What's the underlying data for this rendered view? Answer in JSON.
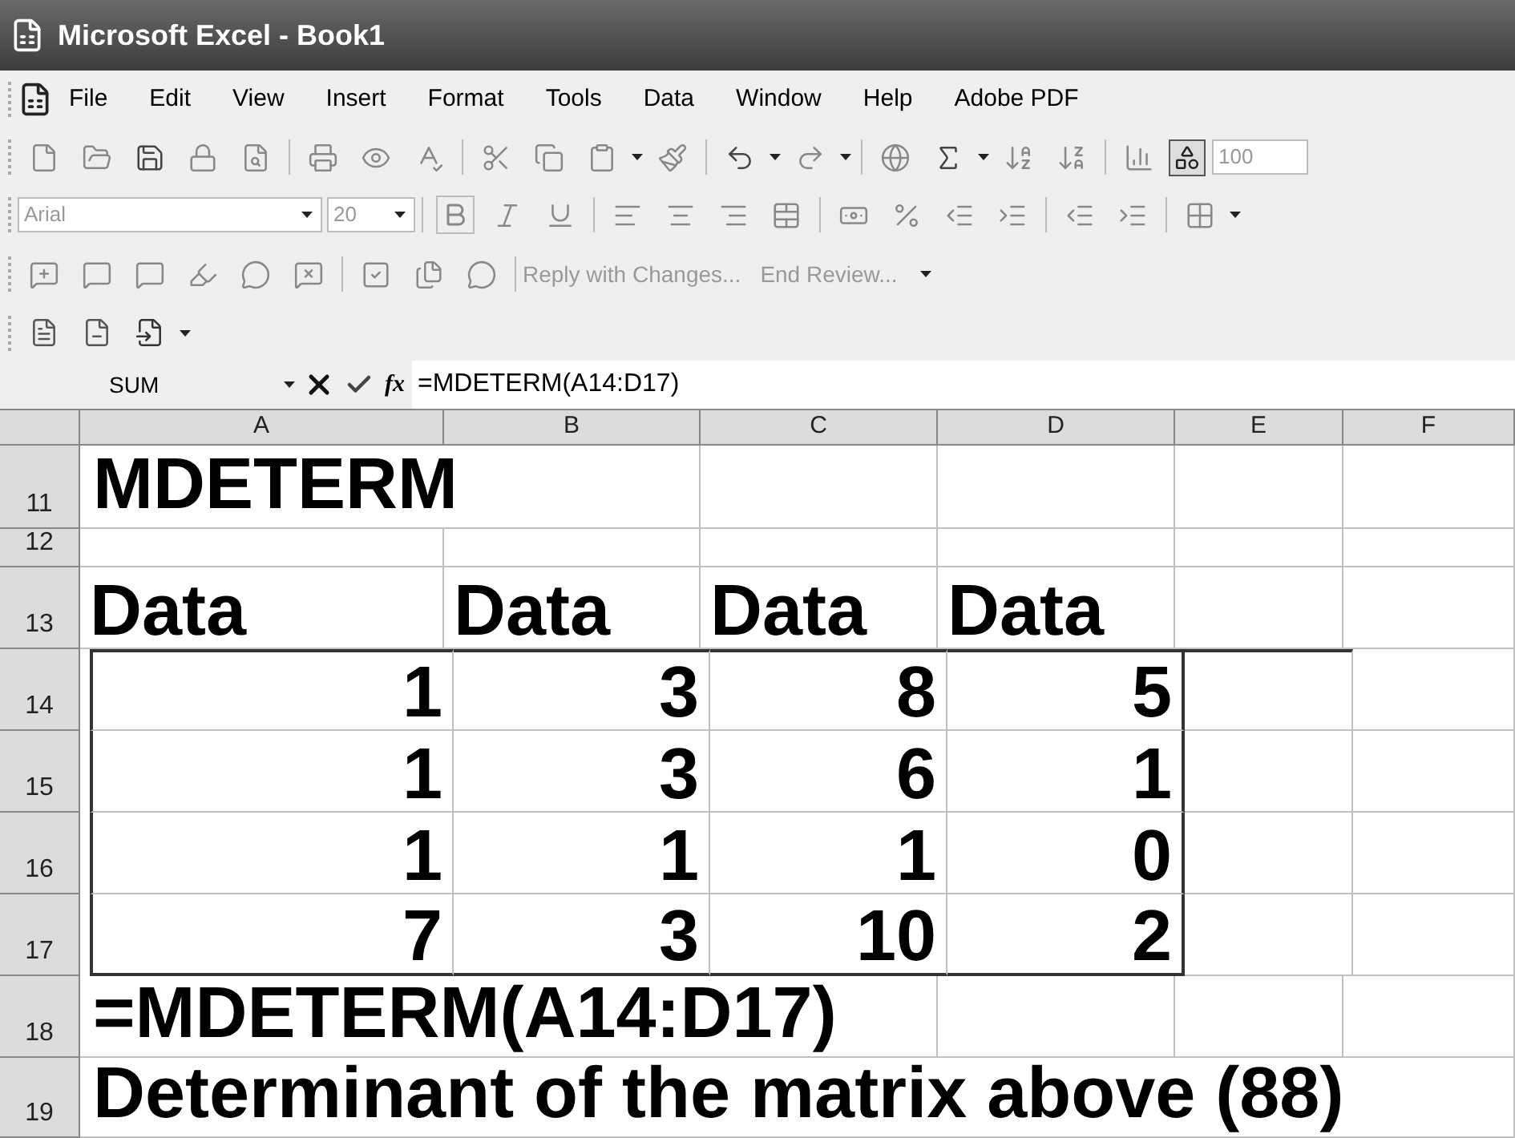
{
  "window": {
    "title": "Microsoft Excel - Book1"
  },
  "menu": [
    "File",
    "Edit",
    "View",
    "Insert",
    "Format",
    "Tools",
    "Data",
    "Window",
    "Help",
    "Adobe PDF"
  ],
  "standard_toolbar": {
    "zoom": "100"
  },
  "formatting_toolbar": {
    "font": "Arial",
    "size": "20"
  },
  "reviewing_toolbar": {
    "buttons": [
      "Reply with Changes...",
      "End Review..."
    ]
  },
  "formula_bar": {
    "name_box": "SUM",
    "function_label": "fx",
    "formula": "=MDETERM(A14:D17)"
  },
  "sheet": {
    "columns": [
      "A",
      "B",
      "C",
      "D",
      "E",
      "F"
    ],
    "rows": [
      {
        "header": "11",
        "kind": "text",
        "text": "MDETERM"
      },
      {
        "header": "12",
        "kind": "empty"
      },
      {
        "header": "13",
        "kind": "label",
        "cells": [
          "Data",
          "Data",
          "Data",
          "Data"
        ]
      },
      {
        "header": "14",
        "kind": "number",
        "cells": [
          "1",
          "3",
          "8",
          "5"
        ]
      },
      {
        "header": "15",
        "kind": "number",
        "cells": [
          "1",
          "3",
          "6",
          "1"
        ]
      },
      {
        "header": "16",
        "kind": "number",
        "cells": [
          "1",
          "1",
          "1",
          "0"
        ]
      },
      {
        "header": "17",
        "kind": "number",
        "cells": [
          "7",
          "3",
          "10",
          "2"
        ]
      },
      {
        "header": "18",
        "kind": "text",
        "text": "=MDETERM(A14:D17)"
      },
      {
        "header": "19",
        "kind": "text",
        "text": "Determinant of the matrix above (88)"
      }
    ]
  }
}
